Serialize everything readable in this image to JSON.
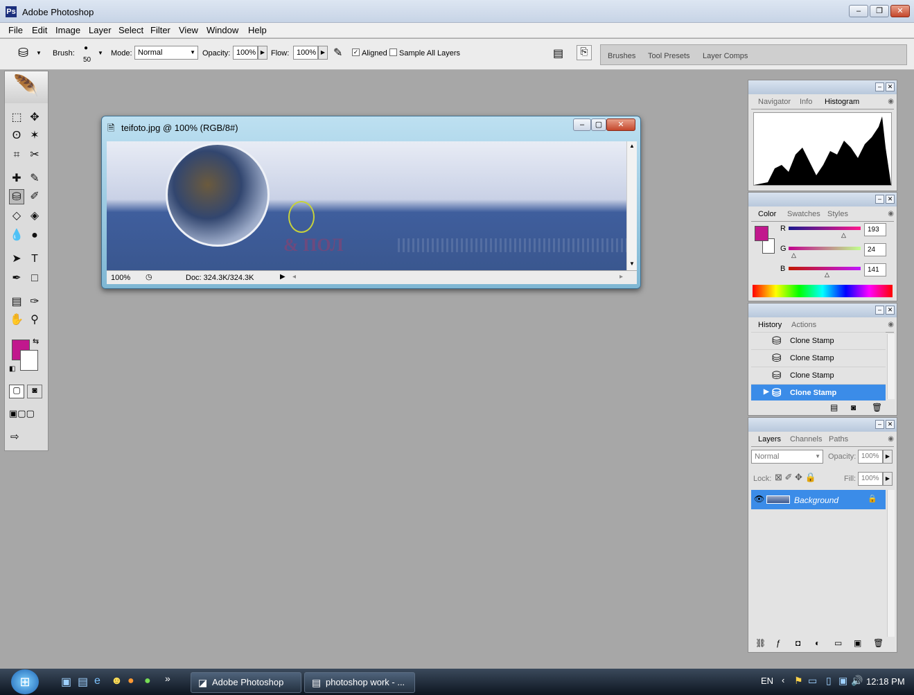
{
  "app": {
    "title": "Adobe Photoshop"
  },
  "menu": [
    "File",
    "Edit",
    "Image",
    "Layer",
    "Select",
    "Filter",
    "View",
    "Window",
    "Help"
  ],
  "options": {
    "brush_label": "Brush:",
    "brush_size": "50",
    "mode_label": "Mode:",
    "mode_value": "Normal",
    "opacity_label": "Opacity:",
    "opacity_value": "100%",
    "flow_label": "Flow:",
    "flow_value": "100%",
    "aligned_label": "Aligned",
    "aligned_checked": true,
    "sample_all_label": "Sample All Layers",
    "sample_all_checked": false
  },
  "palette_well": {
    "tabs": [
      "Brushes",
      "Tool Presets",
      "Layer Comps"
    ]
  },
  "document": {
    "title": "teifoto.jpg @ 100% (RGB/8#)",
    "zoom": "100%",
    "doc_size": "Doc: 324.3K/324.3K",
    "canvas_text": "& ПОЛ"
  },
  "navigator_panel": {
    "tabs": [
      "Navigator",
      "Info",
      "Histogram"
    ],
    "active": "Histogram"
  },
  "color_panel": {
    "tabs": [
      "Color",
      "Swatches",
      "Styles"
    ],
    "active": "Color",
    "r_label": "R",
    "r_value": "193",
    "g_label": "G",
    "g_value": "24",
    "b_label": "B",
    "b_value": "141",
    "foreground": "#c1188d"
  },
  "history_panel": {
    "tabs": [
      "History",
      "Actions"
    ],
    "active": "History",
    "items": [
      {
        "label": "Clone Stamp"
      },
      {
        "label": "Clone Stamp"
      },
      {
        "label": "Clone Stamp"
      },
      {
        "label": "Clone Stamp"
      }
    ]
  },
  "layers_panel": {
    "tabs": [
      "Layers",
      "Channels",
      "Paths"
    ],
    "active": "Layers",
    "blend_mode": "Normal",
    "opacity_label": "Opacity:",
    "opacity_value": "100%",
    "lock_label": "Lock:",
    "fill_label": "Fill:",
    "fill_value": "100%",
    "layers": [
      {
        "name": "Background"
      }
    ]
  },
  "taskbar": {
    "apps": [
      "Adobe Photoshop",
      "photoshop work - ..."
    ],
    "language": "EN",
    "clock": "12:18 PM"
  }
}
